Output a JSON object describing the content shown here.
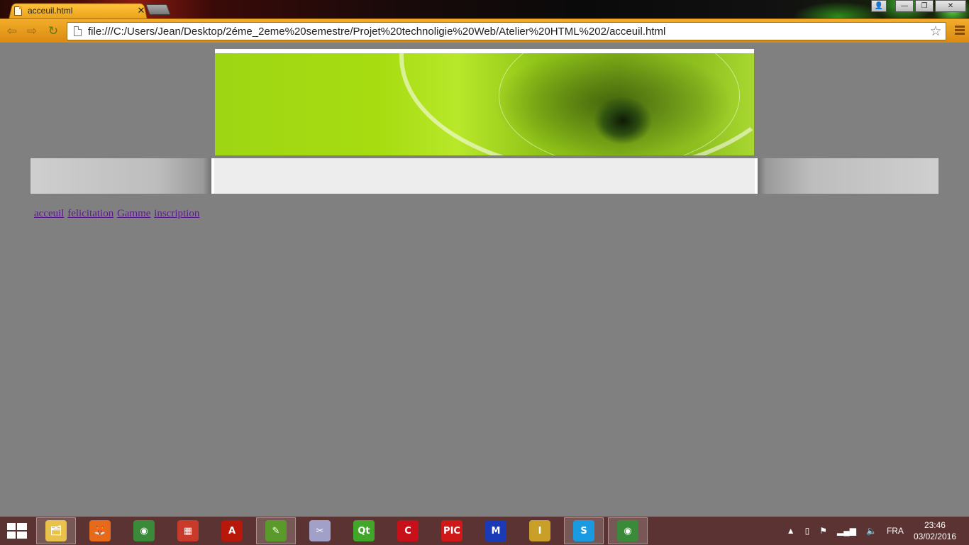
{
  "browser": {
    "tab_title": "acceuil.html",
    "tab_close": "✕",
    "url": "file:///C:/Users/Jean/Desktop/2éme_2eme%20semestre/Projet%20technoligie%20Web/Atelier%20HTML%202/acceuil.html",
    "back_glyph": "⇦",
    "forward_glyph": "⇨",
    "reload_glyph": "↻",
    "star_glyph": "☆",
    "win_user": "👤",
    "win_minimize": "—",
    "win_maximize": "❐",
    "win_close": "✕",
    "accent_color": "#f2ad2a"
  },
  "page": {
    "background": "#808080",
    "nav_links": [
      "acceuil",
      "felicitation",
      "Gamme",
      "inscription"
    ]
  },
  "taskbar": {
    "apps": [
      {
        "name": "file-explorer",
        "glyph": "🗂",
        "color": "#e8c24a",
        "active": true
      },
      {
        "name": "firefox",
        "glyph": "🦊",
        "color": "#e66a1a",
        "active": false
      },
      {
        "name": "chrome",
        "glyph": "◉",
        "color": "#3a8a3a",
        "active": false
      },
      {
        "name": "windows-store",
        "glyph": "▦",
        "color": "#c83a2a",
        "active": false
      },
      {
        "name": "acrobat-reader",
        "glyph": "A",
        "color": "#b8180a",
        "active": false
      },
      {
        "name": "notepad-plus",
        "glyph": "✎",
        "color": "#5a9a2a",
        "active": true
      },
      {
        "name": "snipping-tool",
        "glyph": "✂",
        "color": "#a0a0c8",
        "active": false
      },
      {
        "name": "qt-creator",
        "glyph": "Qt",
        "color": "#41a62a",
        "active": false
      },
      {
        "name": "mikroc",
        "glyph": "C",
        "color": "#c8101a",
        "active": false
      },
      {
        "name": "pic-c",
        "glyph": "PIC",
        "color": "#d01818",
        "active": false
      },
      {
        "name": "mplab-ide",
        "glyph": "M",
        "color": "#1a3ab8",
        "active": false
      },
      {
        "name": "isis-proteus",
        "glyph": "I",
        "color": "#c8a028",
        "active": false
      },
      {
        "name": "skype",
        "glyph": "S",
        "color": "#1a9ae0",
        "active": true
      },
      {
        "name": "chrome-active",
        "glyph": "◉",
        "color": "#3a8a3a",
        "active": true
      }
    ],
    "tray": {
      "show_hidden": "▲",
      "language": "FRA",
      "time": "23:46",
      "date": "03/02/2016"
    }
  }
}
